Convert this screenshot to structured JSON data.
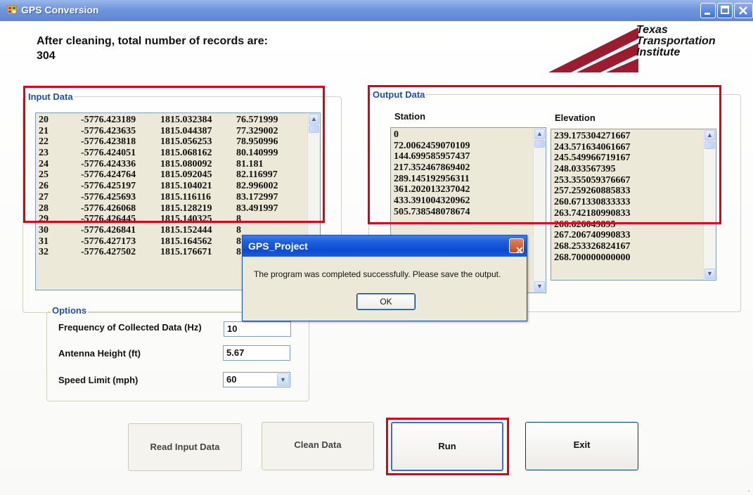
{
  "window": {
    "title": "GPS Conversion"
  },
  "header": {
    "records_line1": "After cleaning, total number of records are:",
    "records_count": "304"
  },
  "logo": {
    "line1": "Texas",
    "line2": "Transportation",
    "line3": "Institute",
    "color": "#9b1c2e"
  },
  "input_data": {
    "legend": "Input Data",
    "rows": [
      [
        "20",
        "-5776.423189",
        "1815.032384",
        "76.571999"
      ],
      [
        "21",
        "-5776.423635",
        "1815.044387",
        "77.329002"
      ],
      [
        "22",
        "-5776.423818",
        "1815.056253",
        "78.950996"
      ],
      [
        "23",
        "-5776.424051",
        "1815.068162",
        "80.140999"
      ],
      [
        "24",
        "-5776.424336",
        "1815.080092",
        "81.181"
      ],
      [
        "25",
        "-5776.424764",
        "1815.092045",
        "82.116997"
      ],
      [
        "26",
        "-5776.425197",
        "1815.104021",
        "82.996002"
      ],
      [
        "27",
        "-5776.425693",
        "1815.116116",
        "83.172997"
      ],
      [
        "28",
        "-5776.426068",
        "1815.128219",
        "83.491997"
      ],
      [
        "29",
        "-5776.426445",
        "1815.140325",
        "8"
      ],
      [
        "30",
        "-5776.426841",
        "1815.152444",
        "8"
      ],
      [
        "31",
        "-5776.427173",
        "1815.164562",
        "8"
      ],
      [
        "32",
        "-5776.427502",
        "1815.176671",
        "8"
      ]
    ]
  },
  "output_data": {
    "legend": "Output Data",
    "station_header": "Station",
    "elevation_header": "Elevation",
    "stations": [
      "0",
      "72.0062459070109",
      "144.699585957437",
      "217.352467869402",
      "289.145192956311",
      "361.202013237042",
      "433.391004320962",
      "505.738548078674"
    ],
    "elevations": [
      "239.175304271667",
      "243.571634061667",
      "245.549966719167",
      "248.033567395",
      "253.355059376667",
      "257.259260885833",
      "260.671330833333",
      "263.742180990833",
      "266.626049895",
      "267.206740990833",
      "268.253326824167",
      "268.700000000000"
    ]
  },
  "options": {
    "legend": "Options",
    "frequency_label": "Frequency of Collected Data (Hz)",
    "frequency_value": "10",
    "antenna_label": "Antenna Height (ft)",
    "antenna_value": "5.67",
    "speed_label": "Speed Limit (mph)",
    "speed_value": "60"
  },
  "buttons": {
    "read": "Read Input Data",
    "clean": "Clean Data",
    "run": "Run",
    "exit": "Exit"
  },
  "dialog": {
    "title": "GPS_Project",
    "message": "The program was completed successfully. Please save the output.",
    "ok": "OK"
  },
  "colors": {
    "highlight_red": "#e0001a",
    "legend_blue": "#1f4fb3",
    "titlebar_blue": "#6f95dc"
  }
}
